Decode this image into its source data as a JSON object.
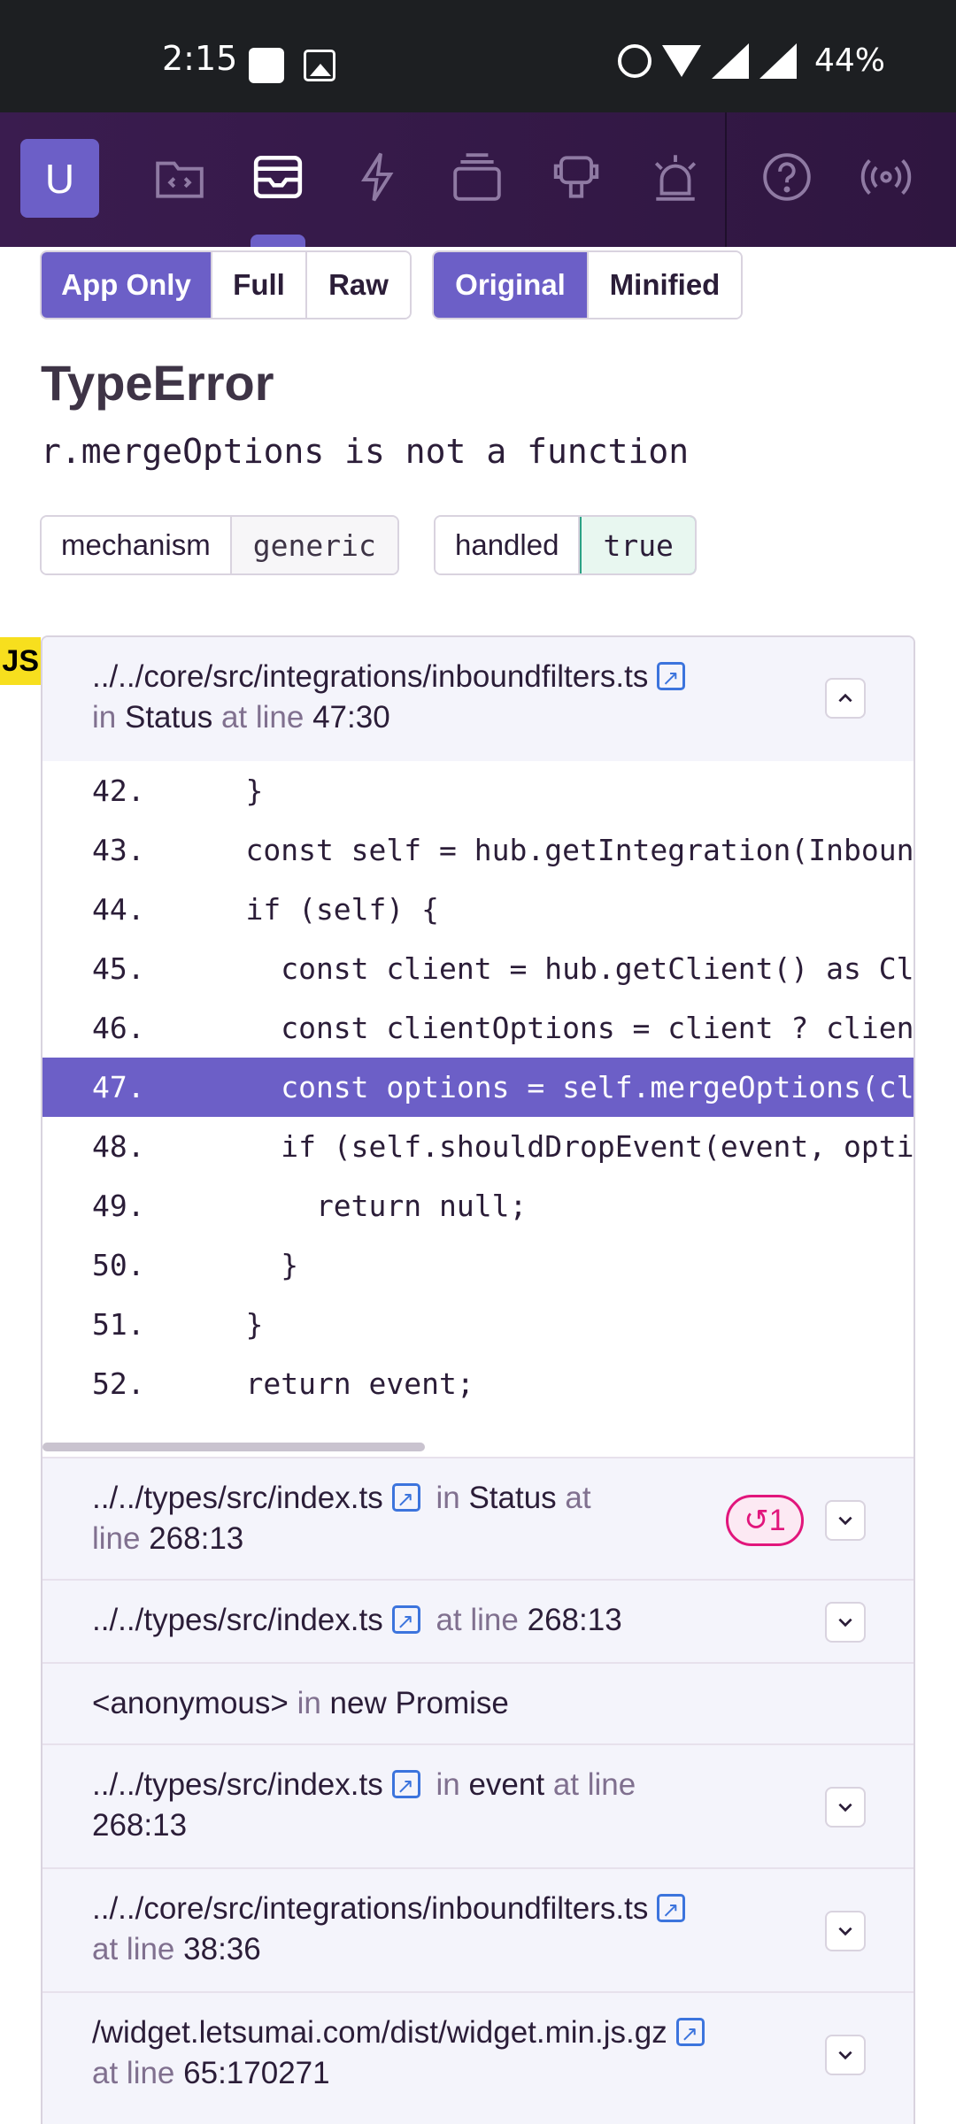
{
  "status_bar": {
    "time": "2:15",
    "battery": "44%"
  },
  "nav": {
    "avatar_letter": "U"
  },
  "toggles": {
    "app_only": "App Only",
    "full": "Full",
    "raw": "Raw",
    "original": "Original",
    "minified": "Minified"
  },
  "error": {
    "type": "TypeError",
    "message": "r.mergeOptions is not a function"
  },
  "tags": [
    {
      "key": "mechanism",
      "value": "generic"
    },
    {
      "key": "handled",
      "value": "true"
    }
  ],
  "platform_badge": "JS",
  "words": {
    "in": "in",
    "at_line": "at line",
    "at": "at",
    "line": "line"
  },
  "expanded_frame": {
    "file": "../../core/src/integrations/inboundfilters.ts",
    "function": "Status",
    "line": "47:30"
  },
  "code_lines": [
    {
      "num": "42.",
      "code": "    }"
    },
    {
      "num": "43.",
      "code": "    const self = hub.getIntegration(InboundFilters);"
    },
    {
      "num": "44.",
      "code": "    if (self) {"
    },
    {
      "num": "45.",
      "code": "      const client = hub.getClient() as Client;"
    },
    {
      "num": "46.",
      "code": "      const clientOptions = client ? client.getOptions() : {};"
    },
    {
      "num": "47.",
      "code": "      const options = self.mergeOptions(clientOptions);"
    },
    {
      "num": "48.",
      "code": "      if (self.shouldDropEvent(event, options)) {"
    },
    {
      "num": "49.",
      "code": "        return null;"
    },
    {
      "num": "50.",
      "code": "      }"
    },
    {
      "num": "51.",
      "code": "    }"
    },
    {
      "num": "52.",
      "code": "    return event;"
    }
  ],
  "frames": [
    {
      "file": "../../types/src/index.ts",
      "function": "Status",
      "line": "268:13",
      "repeat": "1"
    },
    {
      "file": "../../types/src/index.ts",
      "line": "268:13"
    },
    {
      "file": "<anonymous>",
      "function": "new Promise"
    },
    {
      "file": "../../types/src/index.ts",
      "function": "event",
      "line": "268:13"
    },
    {
      "file": "../../core/src/integrations/inboundfilters.ts",
      "line": "38:36"
    },
    {
      "file": "/widget.letsumai.com/dist/widget.min.js.gz",
      "line": "65:170271"
    }
  ]
}
